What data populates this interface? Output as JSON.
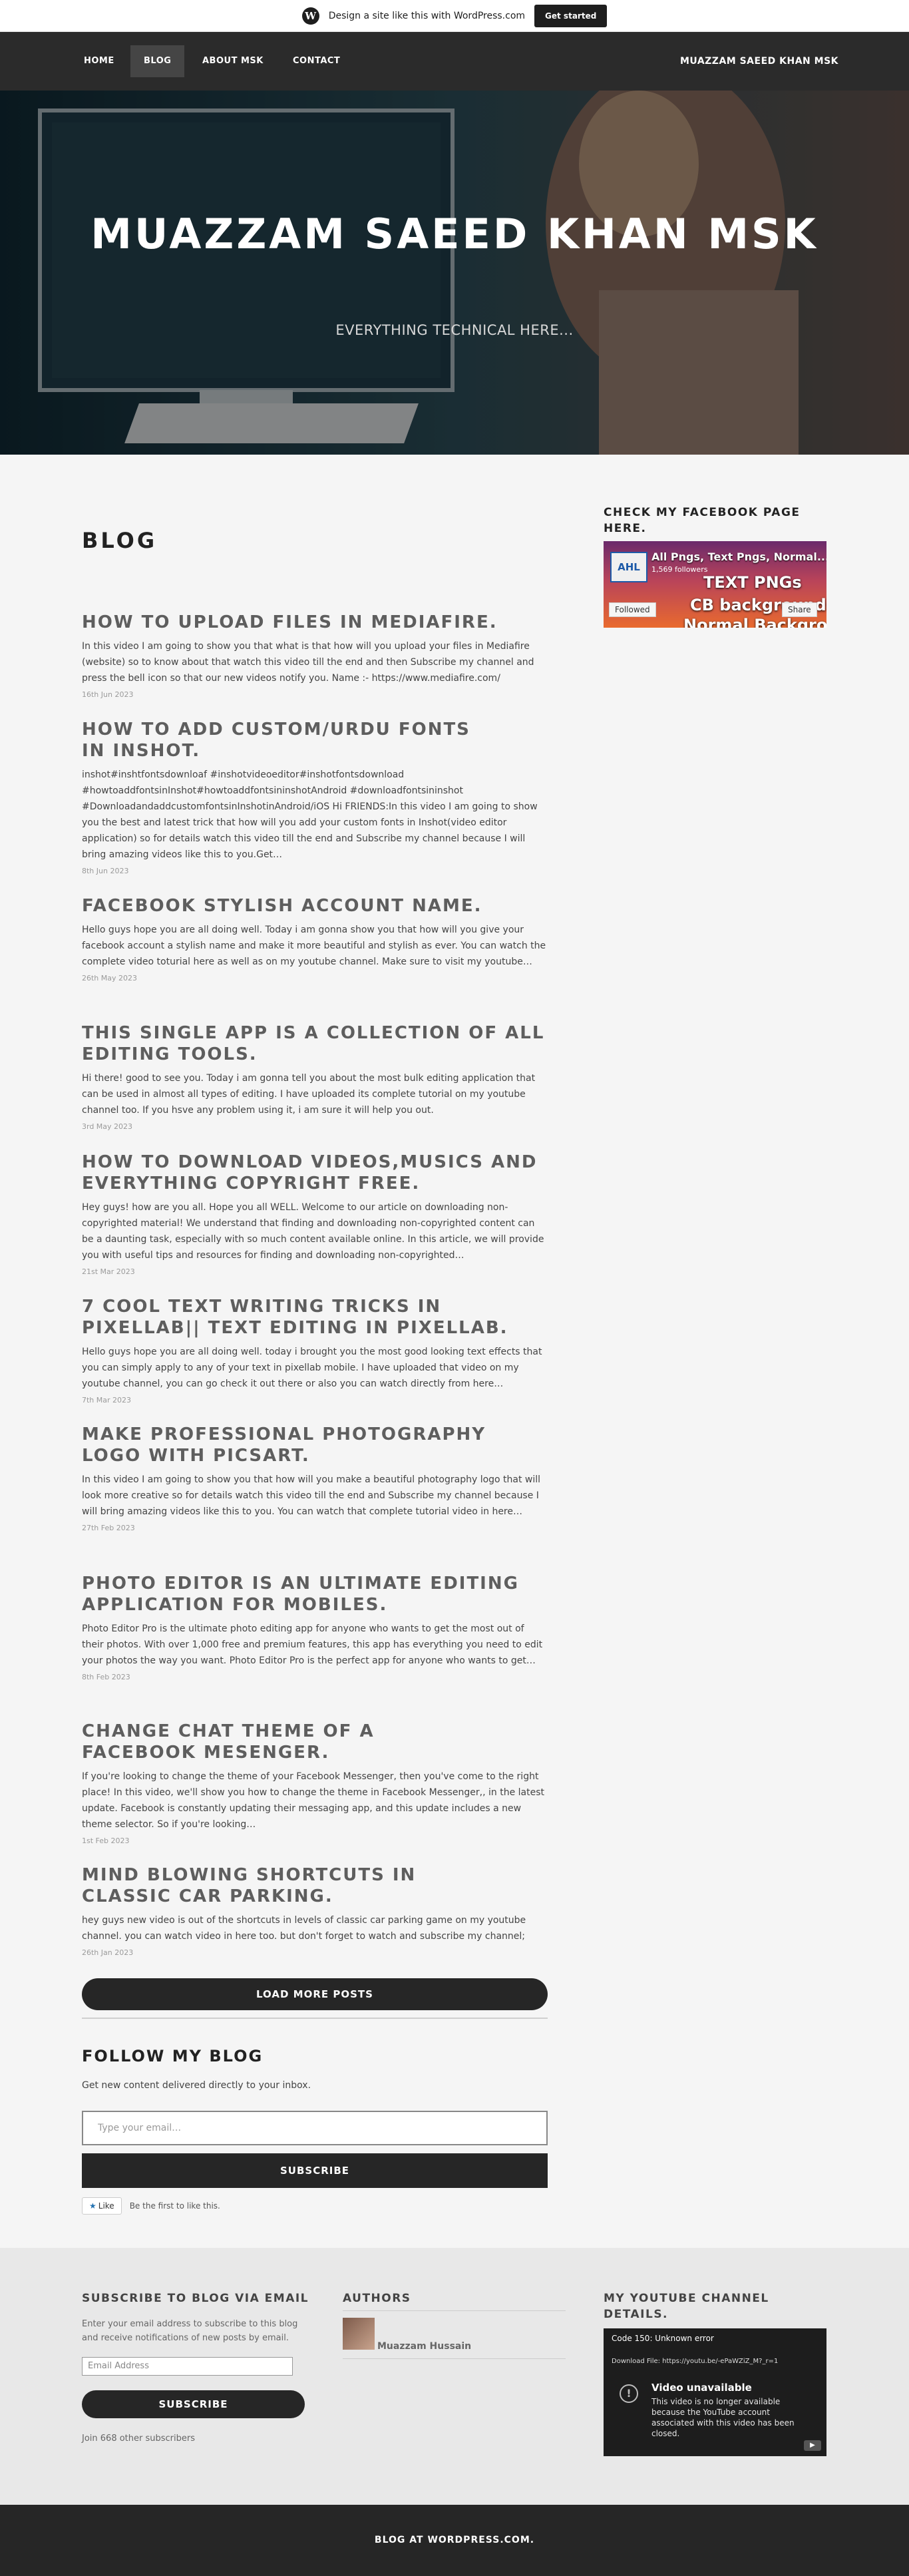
{
  "promo": {
    "text": "Design a site like this with WordPress.com",
    "button": "Get started"
  },
  "nav": {
    "items": [
      "HOME",
      "BLOG",
      "ABOUT MSK",
      "CONTACT"
    ],
    "active": "BLOG",
    "site_name": "MUAZZAM SAEED KHAN MSK"
  },
  "hero": {
    "title": "MUAZZAM SAEED KHAN MSK",
    "subtitle": "EVERYTHING TECHNICAL HERE..."
  },
  "page_title": "BLOG",
  "posts": [
    {
      "title": "HOW TO UPLOAD FILES IN MEDIAFIRE.",
      "excerpt": "In this video I am going to show you that what is that how will you upload your files in Mediafire (website) so to know about that watch this video till the end and then Subscribe my channel and press the bell icon so that our new videos notify you. Name :- https://www.mediafire.com/",
      "date": "16th Jun 2023"
    },
    {
      "title": "HOW TO ADD CUSTOM/URDU FONTS IN INSHOT.",
      "excerpt": "inshot#inshtfontsdownloaf #inshotvideoeditor#inshotfontsdownload #howtoaddfontsinInshot#howtoaddfontsininshotAndroid #downloadfontsininshot #DownloadandaddcustomfontsinInshotinAndroid/iOS Hi FRIENDS:In this video I am going to show you the best and latest trick that how will you add your custom fonts in Inshot(video editor application) so for details watch this video till the end and Subscribe my channel because I will bring amazing videos like this to you.Get…",
      "date": "8th Jun 2023"
    },
    {
      "title": "FACEBOOK STYLISH ACCOUNT NAME.",
      "excerpt": "Hello guys hope you are all doing well. Today i am gonna show you that how will you give your facebook account a stylish name and make it more beautiful and stylish as ever. You can watch the complete video toturial here as well as on my youtube channel. Make sure to visit my youtube…",
      "date": "26th May 2023"
    },
    {
      "title": "THIS SINGLE APP IS A COLLECTION OF ALL EDITING TOOLS.",
      "excerpt": "Hi there! good to see you. Today i am gonna tell you about the most bulk editing application that can be used in almost all types of editing. I have uploaded its complete tutorial on my youtube channel too. If you hsve any problem using it, i am sure it will help you out.",
      "date": "3rd May 2023"
    },
    {
      "title": "HOW TO DOWNLOAD VIDEOS,MUSICS AND EVERYTHING COPYRIGHT FREE.",
      "excerpt": "Hey guys! how are you all. Hope you all WELL. Welcome to our article on downloading non-copyrighted material! We understand that finding and downloading non-copyrighted content can be a daunting task, especially with so much content available online. In this article, we will provide you with useful tips and resources for finding and downloading non-copyrighted…",
      "date": "21st Mar 2023"
    },
    {
      "title": "7 COOL TEXT WRITING TRICKS IN PIXELLAB|| TEXT EDITING IN PIXELLAB.",
      "excerpt": "Hello guys hope you are all doing well. today i brought you the most good looking text effects that you can simply apply to any of your text in pixellab mobile. I have uploaded that video on my youtube channel, you can go check it out there or also you can watch directly from here…",
      "date": "7th Mar 2023"
    },
    {
      "title": "MAKE PROFESSIONAL PHOTOGRAPHY LOGO WITH PICSART.",
      "excerpt": "In this video I am going to show you that how will you make a beautiful photography logo that will look more creative so for details watch this video till the end and Subscribe my channel because I will bring amazing videos like this to you. You can watch that complete tutorial video in here…",
      "date": "27th Feb 2023"
    },
    {
      "title": "PHOTO EDITOR IS AN ULTIMATE EDITING APPLICATION FOR MOBILES.",
      "excerpt": "Photo Editor Pro is the ultimate photo editing app for anyone who wants to get the most out of their photos. With over 1,000 free and premium features, this app has everything you need to edit your photos the way you want. Photo Editor Pro is the perfect app for anyone who wants to get…",
      "date": "8th Feb 2023"
    },
    {
      "title": "CHANGE CHAT THEME OF A FACEBOOK MESENGER.",
      "excerpt": "If you're looking to change the theme of your Facebook Messenger, then you've come to the right place! In this video, we'll show you how to change the theme in Facebook Messenger,, in the latest update. Facebook is constantly updating their messaging app, and this update includes a new theme selector. So if you're looking…",
      "date": "1st Feb 2023"
    },
    {
      "title": "MIND BLOWING SHORTCUTS IN CLASSIC CAR PARKING.",
      "excerpt": "hey guys new video is out of the shortcuts in levels of classic car parking game on my youtube channel. you can watch video in here too. but don't forget to watch and subscribe my channel;",
      "date": "26th Jan 2023"
    }
  ],
  "load_more": "LOAD MORE POSTS",
  "follow": {
    "title": "FOLLOW MY BLOG",
    "description": "Get new content delivered directly to your inbox.",
    "placeholder": "Type your email…",
    "button": "SUBSCRIBE"
  },
  "like": {
    "button": "Like",
    "text": "Be the first to like this."
  },
  "sidebar": {
    "title": "CHECK MY FACEBOOK PAGE HERE.",
    "fb_page": {
      "logo": "AHL",
      "name": "All Pngs, Text Pngs, Normal...",
      "followers": "1,569 followers",
      "line1": "TEXT PNGs",
      "line2": "CB backgrounds",
      "line3": "Normal Backgrounds",
      "follow_btn": "Followed",
      "share_btn": "Share"
    }
  },
  "footer_widgets": {
    "subscribe": {
      "title": "SUBSCRIBE TO BLOG VIA EMAIL",
      "description": "Enter your email address to subscribe to this blog and receive notifications of new posts by email.",
      "placeholder": "Email Address",
      "button": "SUBSCRIBE",
      "count_text": "Join 668 other subscribers"
    },
    "authors": {
      "title": "AUTHORS",
      "name": "Muazzam Hussain"
    },
    "youtube": {
      "title": "MY YOUTUBE CHANNEL DETAILS.",
      "error_code": "Code 150: Unknown error",
      "download_line": "Download File: https://youtu.be/-ePaWZiZ_M?_r=1",
      "unavailable": "Video unavailable",
      "message": "This video is no longer available because the YouTube account associated with this video has been closed."
    }
  },
  "footer": {
    "text": "BLOG AT WORDPRESS.COM."
  }
}
